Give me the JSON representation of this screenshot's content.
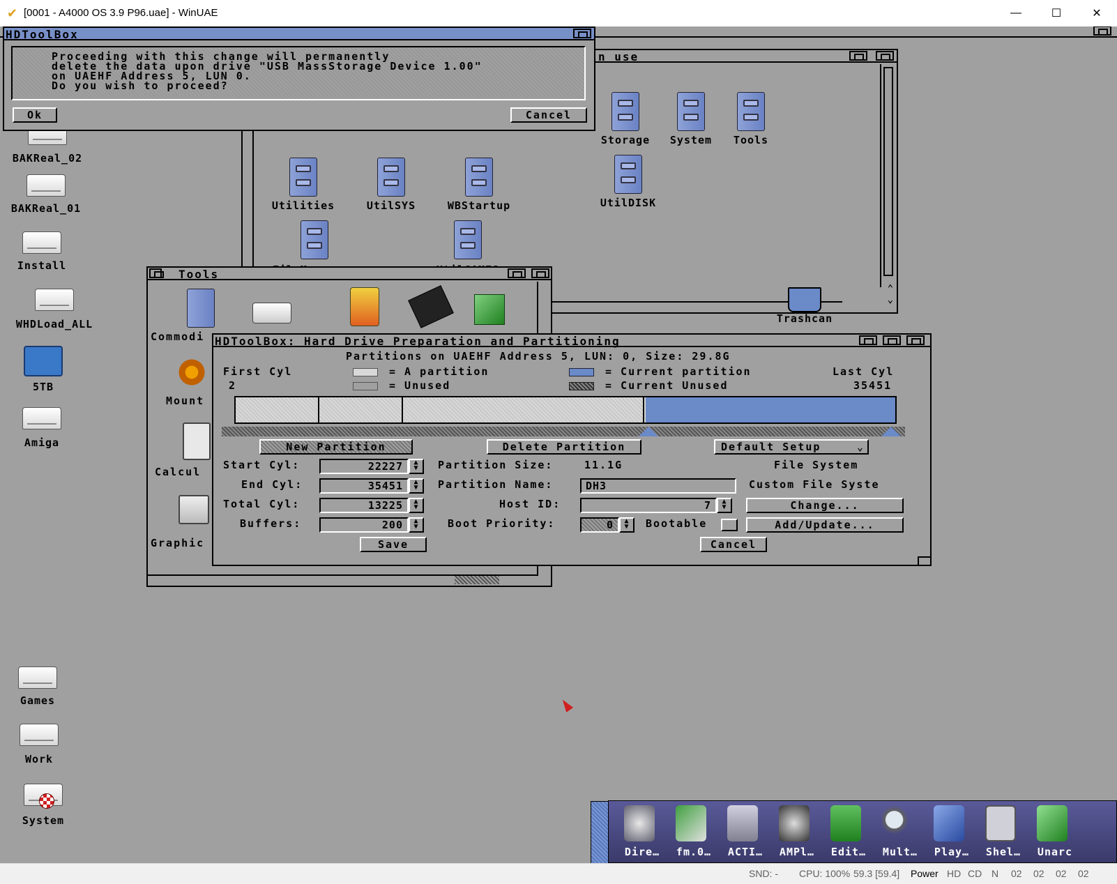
{
  "window": {
    "title": "[0001 - A4000 OS 3.9 P96.uae] - WinUAE",
    "minimize": "—",
    "maximize": "☐",
    "close": "✕"
  },
  "desktop_icons": [
    {
      "label": "BAKReal_02",
      "kind": "drive"
    },
    {
      "label": "BAKReal_01",
      "kind": "drive"
    },
    {
      "label": "Install",
      "kind": "drive"
    },
    {
      "label": "WHDLoad_ALL",
      "kind": "drive"
    },
    {
      "label": "5TB",
      "kind": "blue-drive"
    },
    {
      "label": "Amiga",
      "kind": "drive"
    },
    {
      "label": "Games",
      "kind": "drive"
    },
    {
      "label": "Work",
      "kind": "drive"
    },
    {
      "label": "System",
      "kind": "drive"
    }
  ],
  "back_window": {
    "title": "n use",
    "icons": [
      "Storage",
      "System",
      "Tools",
      "Utilities",
      "UtilSYS",
      "WBStartup",
      "UtilDISK",
      "FileManagers",
      "UtilGAMES"
    ],
    "trashcan": "Trashcan"
  },
  "tools_window": {
    "title": "Tools",
    "items": [
      "Commodi",
      "Mount",
      "Calcul",
      "Graphic"
    ]
  },
  "requester": {
    "title": "HDToolBox",
    "line1": "Proceeding with this change will permanently",
    "line2": "delete the data upon drive \"USB MassStorage Device  1.00\"",
    "line3": "on UAEHF Address 5, LUN 0.",
    "line4": "Do you wish to proceed?",
    "ok": "Ok",
    "cancel": "Cancel"
  },
  "partition_window": {
    "title": "HDToolBox: Hard Drive Preparation and Partitioning",
    "header": "Partitions on UAEHF Address 5, LUN: 0, Size: 29.8G",
    "first_cyl_label": "First Cyl",
    "first_cyl": "2",
    "last_cyl_label": "Last Cyl",
    "last_cyl": "35451",
    "legend_a": "= A partition",
    "legend_unused": "= Unused",
    "legend_current": "= Current partition",
    "legend_current_unused": "= Current Unused",
    "new_partition": "New Partition",
    "delete_partition": "Delete Partition",
    "default_setup": "Default Setup",
    "start_cyl_label": "Start Cyl:",
    "start_cyl": "22227",
    "end_cyl_label": "End Cyl:",
    "end_cyl": "35451",
    "total_cyl_label": "Total Cyl:",
    "total_cyl": "13225",
    "buffers_label": "Buffers:",
    "buffers": "200",
    "partition_size_label": "Partition Size:",
    "partition_size": "11.1G",
    "partition_name_label": "Partition Name:",
    "partition_name": "DH3",
    "host_id_label": "Host ID:",
    "host_id": "7",
    "boot_priority_label": "Boot Priority:",
    "boot_priority": "0",
    "bootable_label": "Bootable",
    "file_system_label": "File System",
    "custom_fs": "Custom File Syste",
    "change": "Change...",
    "add_update": "Add/Update...",
    "save": "Save",
    "cancel": "Cancel",
    "current_color": "#6a8ac8"
  },
  "dock": [
    "Dire…",
    "fm.0…",
    "ACTI…",
    "AMPl…",
    "Edit…",
    "Mult…",
    "Play…",
    "Shel…",
    "Unarc"
  ],
  "status": {
    "snd": "SND: -",
    "cpu": "CPU: 100%",
    "fps": "59.3 [59.4]",
    "power": "Power",
    "hd": "HD",
    "cd": "CD",
    "n": "N",
    "d0": "02",
    "d1": "02",
    "d2": "02",
    "d3": "02"
  }
}
